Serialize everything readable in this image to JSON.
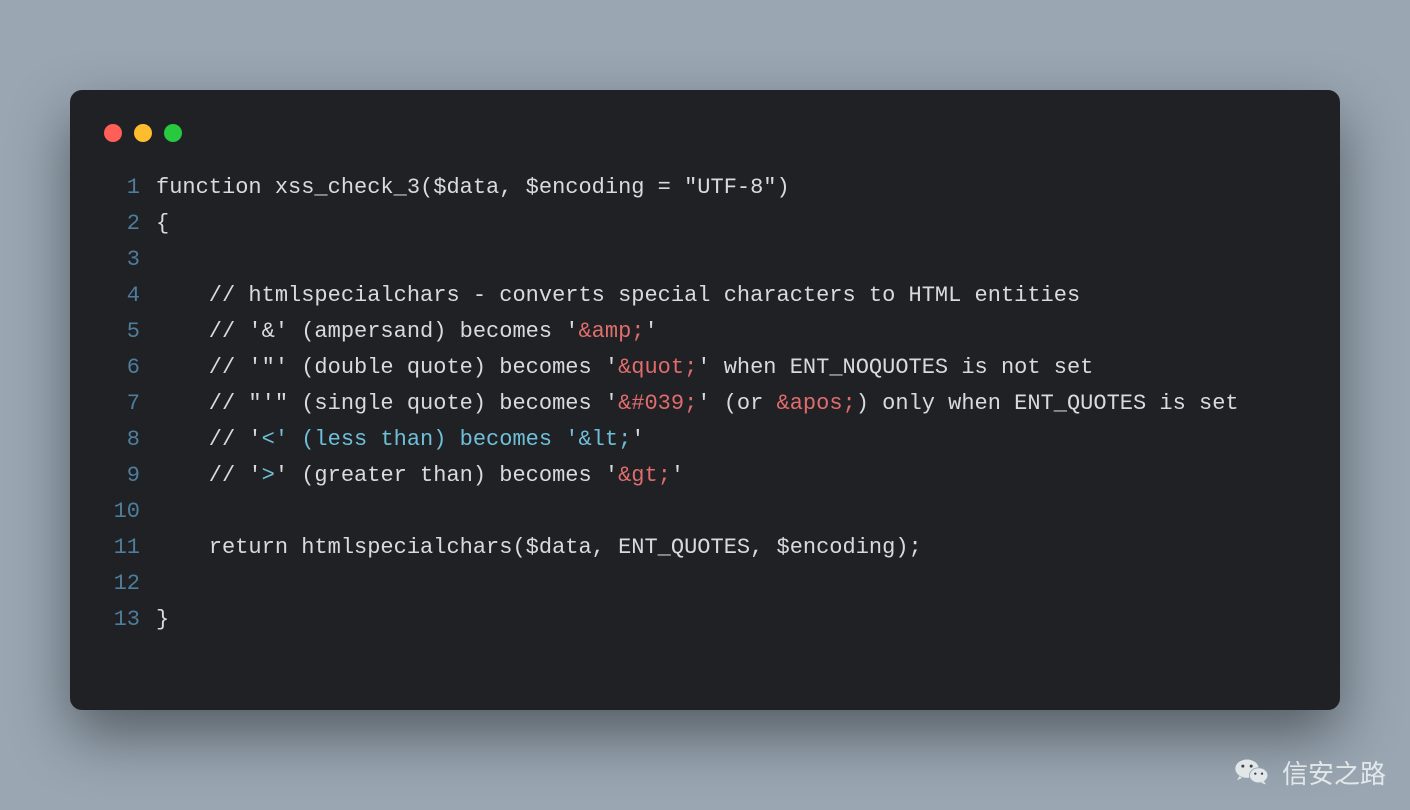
{
  "window": {
    "traffic_lights": [
      "close",
      "minimize",
      "zoom"
    ]
  },
  "code": {
    "lines": [
      {
        "n": "1",
        "segments": [
          {
            "t": "function xss_check_3($data, $encoding = \"UTF-8\")",
            "c": ""
          }
        ]
      },
      {
        "n": "2",
        "segments": [
          {
            "t": "{",
            "c": ""
          }
        ]
      },
      {
        "n": "3",
        "segments": [
          {
            "t": "",
            "c": ""
          }
        ]
      },
      {
        "n": "4",
        "segments": [
          {
            "t": "    // htmlspecialchars - converts special characters to HTML entities",
            "c": ""
          }
        ]
      },
      {
        "n": "5",
        "segments": [
          {
            "t": "    // '&' (ampersand) becomes '",
            "c": ""
          },
          {
            "t": "&amp;",
            "c": "red"
          },
          {
            "t": "'",
            "c": ""
          }
        ]
      },
      {
        "n": "6",
        "segments": [
          {
            "t": "    // '\"' (double quote) becomes '",
            "c": ""
          },
          {
            "t": "&quot;",
            "c": "red"
          },
          {
            "t": "' when ENT_NOQUOTES is not set",
            "c": ""
          }
        ]
      },
      {
        "n": "7",
        "segments": [
          {
            "t": "    // \"'\" (single quote) becomes '",
            "c": ""
          },
          {
            "t": "&#039;",
            "c": "red"
          },
          {
            "t": "' (or ",
            "c": ""
          },
          {
            "t": "&apos;",
            "c": "red"
          },
          {
            "t": ") only when ENT_QUOTES is set",
            "c": ""
          }
        ]
      },
      {
        "n": "8",
        "segments": [
          {
            "t": "    // '",
            "c": ""
          },
          {
            "t": "<' (less than) becomes '&lt;",
            "c": "cyan"
          },
          {
            "t": "'",
            "c": ""
          }
        ]
      },
      {
        "n": "9",
        "segments": [
          {
            "t": "    // '",
            "c": ""
          },
          {
            "t": ">",
            "c": "cyan"
          },
          {
            "t": "' (greater than) becomes '",
            "c": ""
          },
          {
            "t": "&gt;",
            "c": "red"
          },
          {
            "t": "'",
            "c": ""
          }
        ]
      },
      {
        "n": "10",
        "segments": [
          {
            "t": " ",
            "c": ""
          }
        ]
      },
      {
        "n": "11",
        "segments": [
          {
            "t": "    return htmlspecialchars($data, ENT_QUOTES, $encoding);",
            "c": ""
          }
        ]
      },
      {
        "n": "12",
        "segments": [
          {
            "t": " ",
            "c": ""
          }
        ]
      },
      {
        "n": "13",
        "segments": [
          {
            "t": "}",
            "c": ""
          }
        ]
      }
    ]
  },
  "watermark": {
    "label": "信安之路",
    "icon": "wechat-icon"
  }
}
